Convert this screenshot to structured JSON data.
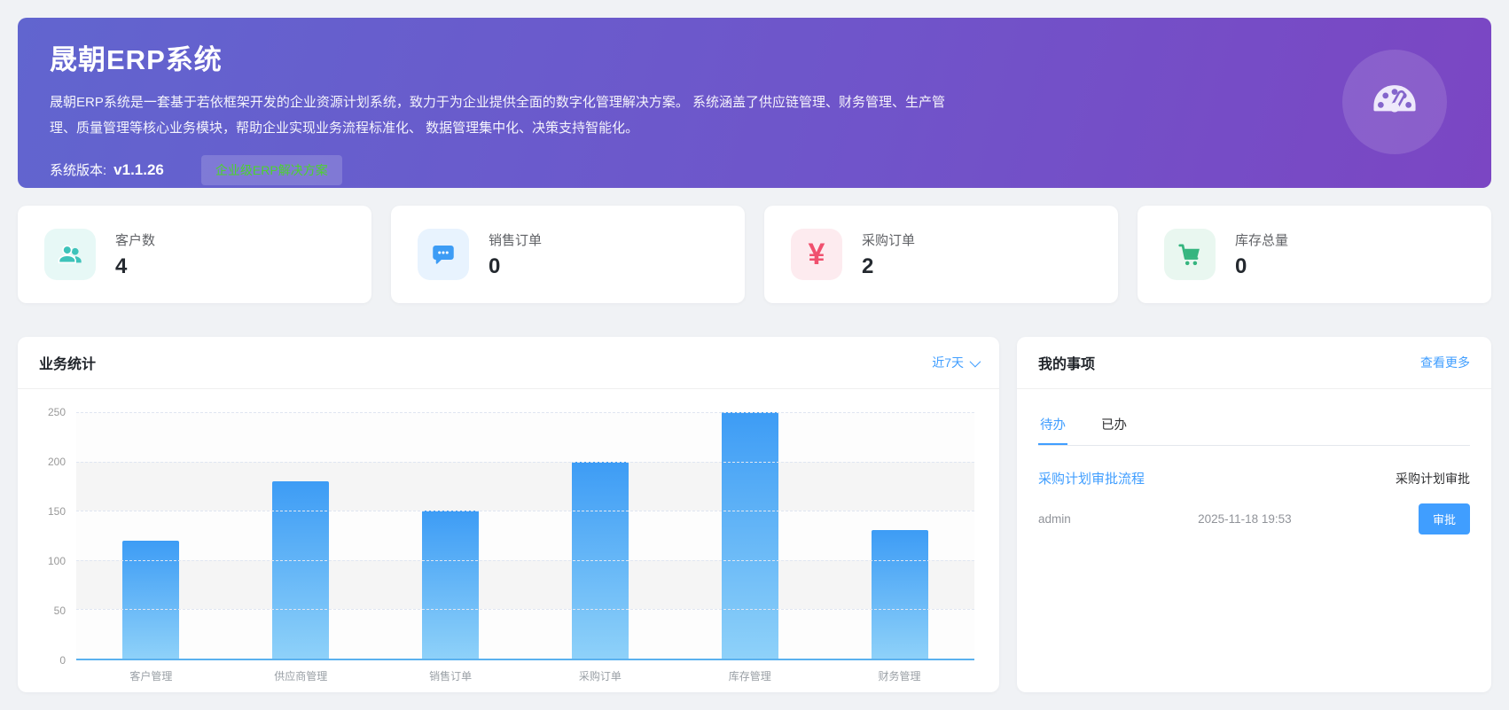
{
  "banner": {
    "title": "晟朝ERP系统",
    "description": "晟朝ERP系统是一套基于若依框架开发的企业资源计划系统，致力于为企业提供全面的数字化管理解决方案。 系统涵盖了供应链管理、财务管理、生产管理、质量管理等核心业务模块，帮助企业实现业务流程标准化、 数据管理集中化、决策支持智能化。",
    "version_label": "系统版本:",
    "version_value": "v1.1.26",
    "badge": "企业级ERP解决方案",
    "icon": "gauge-icon",
    "colors": {
      "gradient_start": "#6165cf",
      "gradient_end": "#7b46c3",
      "badge_text": "#4cd32d"
    }
  },
  "stat_cards": [
    {
      "label": "客户数",
      "value": "4",
      "icon": "users-icon",
      "color": "#3ec3ba",
      "bg": "#e7f8f6"
    },
    {
      "label": "销售订单",
      "value": "0",
      "icon": "chat-icon",
      "color": "#3d9cf5",
      "bg": "#e8f3fe"
    },
    {
      "label": "采购订单",
      "value": "2",
      "icon": "yen-icon",
      "color": "#f0506e",
      "bg": "#fdebef"
    },
    {
      "label": "库存总量",
      "value": "0",
      "icon": "cart-icon",
      "color": "#35b57f",
      "bg": "#e9f7f0"
    }
  ],
  "chart_panel": {
    "title": "业务统计",
    "range_selector": "近7天"
  },
  "chart_data": {
    "type": "bar",
    "title": "业务统计",
    "categories": [
      "客户管理",
      "供应商管理",
      "销售订单",
      "采购订单",
      "库存管理",
      "财务管理"
    ],
    "values": [
      120,
      180,
      150,
      200,
      250,
      130
    ],
    "xlabel": "",
    "ylabel": "",
    "ylim": [
      0,
      250
    ],
    "yticks": [
      0,
      50,
      100,
      150,
      200,
      250
    ],
    "grid": "dashed",
    "split_area": true,
    "legend": false,
    "bar_gradient": [
      "#3d9cf5",
      "#8ed1f9"
    ],
    "axis_line_color": "#5ab1ef"
  },
  "tasks_panel": {
    "title": "我的事项",
    "more_link": "查看更多",
    "tabs": [
      {
        "label": "待办",
        "active": true
      },
      {
        "label": "已办",
        "active": false
      }
    ],
    "items": [
      {
        "process_name": "采购计划审批流程",
        "task_name": "采购计划审批",
        "assignee": "admin",
        "time": "2025-11-18 19:53",
        "action_label": "审批"
      }
    ]
  },
  "colors": {
    "accent": "#409EFF",
    "page_bg": "#f0f2f5"
  }
}
